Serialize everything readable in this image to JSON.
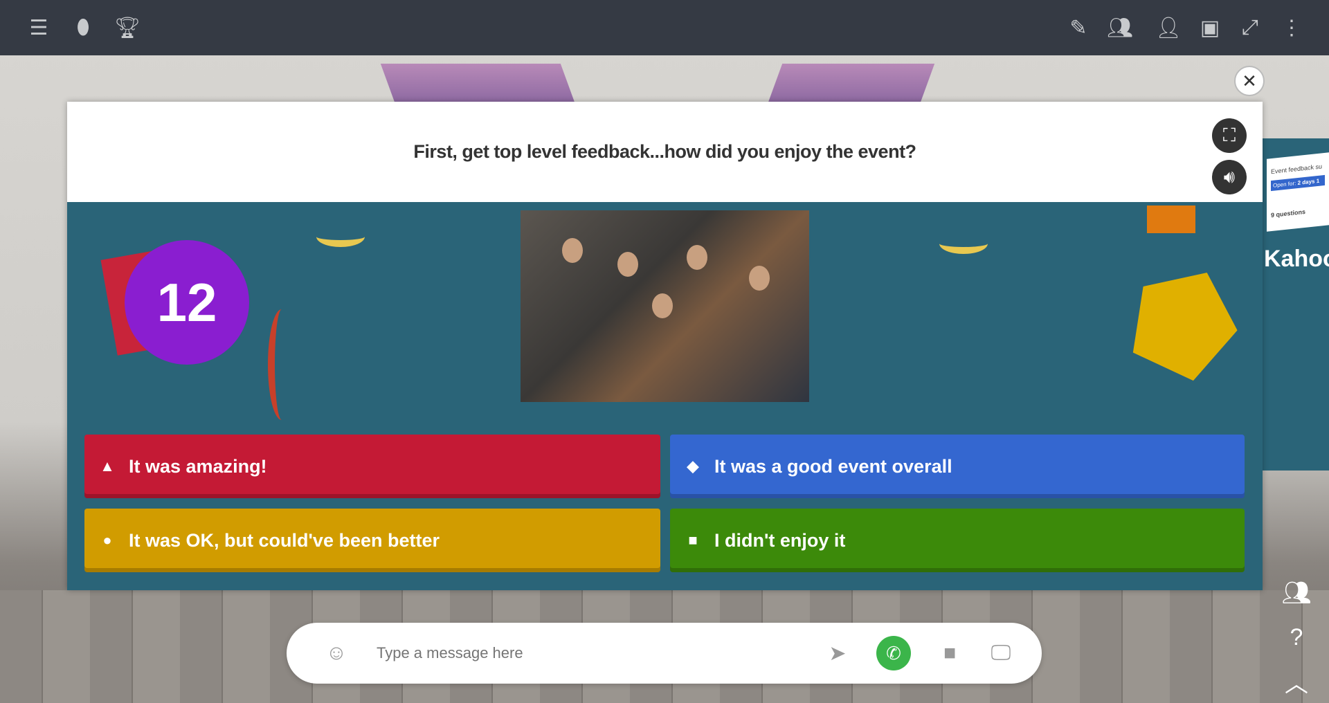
{
  "topbar": {
    "left_icons": [
      "menu-icon",
      "map-pin-icon",
      "trophy-icon"
    ],
    "right_icons": [
      "edit-add-icon",
      "group-icon",
      "add-user-icon",
      "vr-icon",
      "expand-icon",
      "more-vertical-icon"
    ]
  },
  "quiz": {
    "question": "First, get top level feedback...how did you enjoy the event?",
    "timer": "12",
    "answers": [
      {
        "label": "It was amazing!",
        "shape": "triangle",
        "color": "#c41a35"
      },
      {
        "label": "It was a good event overall",
        "shape": "diamond",
        "color": "#3467d0"
      },
      {
        "label": "It was OK, but could've been better",
        "shape": "circle",
        "color": "#d19c00"
      },
      {
        "label": "I didn't enjoy it",
        "shape": "square",
        "color": "#3c8a0a"
      }
    ],
    "timer_color": "#8a1ed0",
    "background_color": "#2a6478"
  },
  "side_panel": {
    "card_title": "Event feedback su",
    "open_for_label": "Open for:",
    "open_for_value": "2 days 1",
    "questions": "9 questions",
    "brand": "Kahoot!"
  },
  "chat": {
    "placeholder": "Type a message here"
  }
}
